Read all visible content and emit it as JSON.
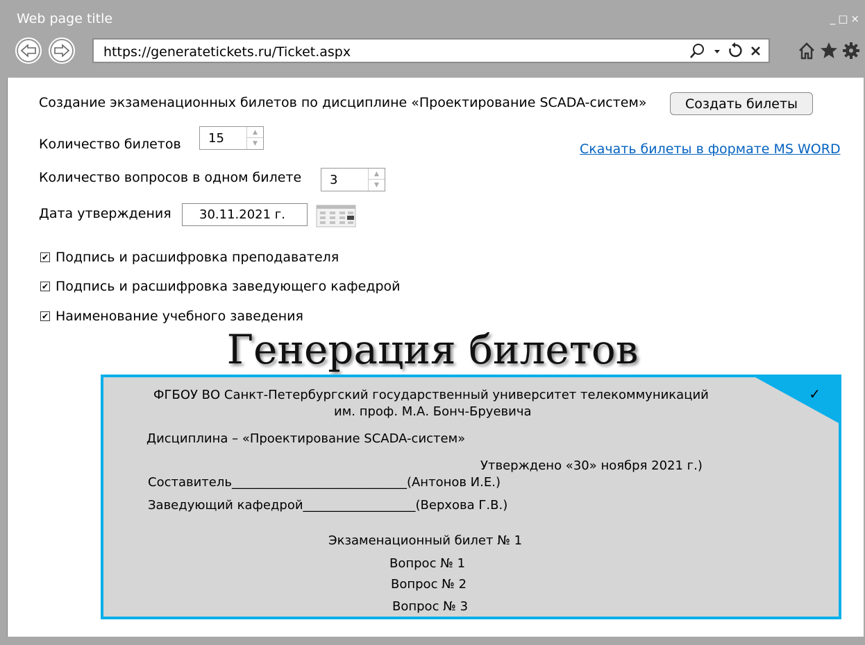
{
  "window": {
    "title": "Web page title",
    "controls": [
      "_",
      "□",
      "×"
    ]
  },
  "nav": {
    "url": "https://generatetickets.ru/Ticket.aspx",
    "url_icons": [
      "search-icon",
      "dropdown-icon",
      "refresh-icon",
      "stop-icon"
    ],
    "tool_icons": [
      "home-icon",
      "star-icon",
      "gear-icon"
    ]
  },
  "form": {
    "heading": "Создание экзаменационных билетов по дисциплине «Проектирование SCADA-систем»",
    "create_button": "Создать билеты",
    "tickets_label": "Количество билетов",
    "tickets_value": "15",
    "questions_label": "Количество вопросов в одном билете",
    "questions_value": "3",
    "download_link": "Скачать билеты в формате MS WORD",
    "date_label": "Дата утверждения",
    "date_value": "30.11.2021  г.",
    "checkboxes": [
      {
        "label": "Подпись и расшифровка преподавателя",
        "checked": true
      },
      {
        "label": "Подпись и расшифровка заведующего кафедрой",
        "checked": true
      },
      {
        "label": "Наименование учебного заведения",
        "checked": true
      }
    ]
  },
  "big_title": "Генерация билетов",
  "ticket": {
    "university_line1": "ФГБОУ ВО Санкт-Петербургский государственный университет телекоммуникаций",
    "university_line2": "им. проф. М.А. Бонч-Бруевича",
    "discipline": "Дисциплина – «Проектирование SCADA-систем»",
    "approved": "Утверждено «30» ноября 2021 г.)",
    "author": "Составитель____________________________(Антонов  И.Е.)",
    "head": "Заведующий кафедрой__________________(Верхова  Г.В.)",
    "ticket_number": "Экзаменационный билет № 1",
    "questions": [
      "Вопрос № 1",
      "Вопрос № 2",
      "Вопрос № 3"
    ],
    "check_mark": "✓",
    "accent_color": "#0aafea",
    "background_color": "#d6d6d6"
  }
}
